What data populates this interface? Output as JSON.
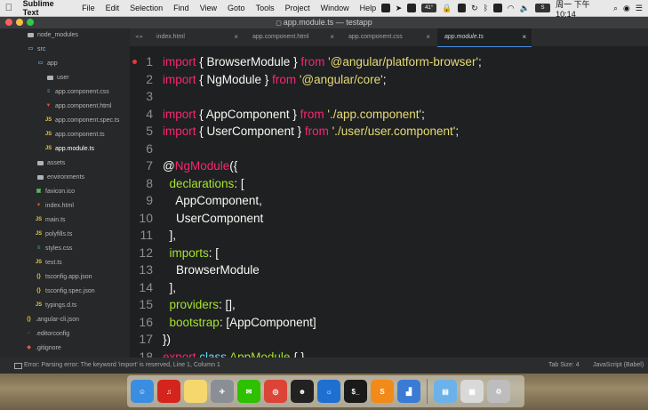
{
  "menubar": {
    "app_name": "Sublime Text",
    "items": [
      "File",
      "Edit",
      "Selection",
      "Find",
      "View",
      "Goto",
      "Tools",
      "Project",
      "Window",
      "Help"
    ],
    "badges": [
      "41°",
      "S"
    ],
    "clock": "周一 下午10:14"
  },
  "window": {
    "title": "app.module.ts — testapp"
  },
  "sidebar": {
    "items": [
      {
        "label": "node_modules",
        "type": "folder"
      },
      {
        "label": "src",
        "type": "folder"
      },
      {
        "label": "app",
        "type": "folder"
      },
      {
        "label": "user",
        "type": "folder"
      },
      {
        "label": "app.component.css",
        "type": "css"
      },
      {
        "label": "app.component.html",
        "type": "html"
      },
      {
        "label": "app.component.spec.ts",
        "type": "js"
      },
      {
        "label": "app.component.ts",
        "type": "js"
      },
      {
        "label": "app.module.ts",
        "type": "js"
      },
      {
        "label": "assets",
        "type": "folder"
      },
      {
        "label": "environments",
        "type": "folder"
      },
      {
        "label": "favicon.ico",
        "type": "img"
      },
      {
        "label": "index.html",
        "type": "html"
      },
      {
        "label": "main.ts",
        "type": "js"
      },
      {
        "label": "polyfills.ts",
        "type": "js"
      },
      {
        "label": "styles.css",
        "type": "css"
      },
      {
        "label": "test.ts",
        "type": "js"
      },
      {
        "label": "tsconfig.app.json",
        "type": "json"
      },
      {
        "label": "tsconfig.spec.json",
        "type": "json"
      },
      {
        "label": "typings.d.ts",
        "type": "js"
      },
      {
        "label": ".angular-cli.json",
        "type": "json"
      },
      {
        "label": ".editorconfig",
        "type": "config"
      },
      {
        "label": ".gitignore",
        "type": "git"
      }
    ]
  },
  "tabs": [
    {
      "label": "index.html"
    },
    {
      "label": "app.component.html"
    },
    {
      "label": "app.component.css"
    },
    {
      "label": "app.module.ts"
    }
  ],
  "tab_nav": "◂ ▸",
  "tab_close": "×",
  "code": {
    "lines": [
      {
        "n": "1",
        "t": [
          [
            "kw",
            "import"
          ],
          [
            "punc",
            " { BrowserModule } "
          ],
          [
            "kw",
            "from"
          ],
          [
            "punc",
            " "
          ],
          [
            "str",
            "'@angular/platform-browser'"
          ],
          [
            "punc",
            ";"
          ]
        ]
      },
      {
        "n": "2",
        "t": [
          [
            "kw",
            "import"
          ],
          [
            "punc",
            " { NgModule } "
          ],
          [
            "kw",
            "from"
          ],
          [
            "punc",
            " "
          ],
          [
            "str",
            "'@angular/core'"
          ],
          [
            "punc",
            ";"
          ]
        ]
      },
      {
        "n": "3",
        "t": []
      },
      {
        "n": "4",
        "t": [
          [
            "kw",
            "import"
          ],
          [
            "punc",
            " { AppComponent } "
          ],
          [
            "kw",
            "from"
          ],
          [
            "punc",
            " "
          ],
          [
            "str",
            "'./app.component'"
          ],
          [
            "punc",
            ";"
          ]
        ]
      },
      {
        "n": "5",
        "t": [
          [
            "kw",
            "import"
          ],
          [
            "punc",
            " { UserComponent } "
          ],
          [
            "kw",
            "from"
          ],
          [
            "punc",
            " "
          ],
          [
            "str",
            "'./user/user.component'"
          ],
          [
            "punc",
            ";"
          ]
        ]
      },
      {
        "n": "6",
        "t": []
      },
      {
        "n": "7",
        "t": [
          [
            "punc",
            "@"
          ],
          [
            "kw",
            "NgModule"
          ],
          [
            "punc",
            "({"
          ]
        ]
      },
      {
        "n": "8",
        "t": [
          [
            "punc",
            "  "
          ],
          [
            "fn",
            "declarations"
          ],
          [
            "punc",
            ": ["
          ]
        ]
      },
      {
        "n": "9",
        "t": [
          [
            "punc",
            "    AppComponent,"
          ]
        ]
      },
      {
        "n": "10",
        "t": [
          [
            "punc",
            "    UserComponent"
          ]
        ]
      },
      {
        "n": "11",
        "t": [
          [
            "punc",
            "  ],"
          ]
        ]
      },
      {
        "n": "12",
        "t": [
          [
            "punc",
            "  "
          ],
          [
            "fn",
            "imports"
          ],
          [
            "punc",
            ": ["
          ]
        ]
      },
      {
        "n": "13",
        "t": [
          [
            "punc",
            "    BrowserModule"
          ]
        ]
      },
      {
        "n": "14",
        "t": [
          [
            "punc",
            "  ],"
          ]
        ]
      },
      {
        "n": "15",
        "t": [
          [
            "punc",
            "  "
          ],
          [
            "fn",
            "providers"
          ],
          [
            "punc",
            ": [],"
          ]
        ]
      },
      {
        "n": "16",
        "t": [
          [
            "punc",
            "  "
          ],
          [
            "fn",
            "bootstrap"
          ],
          [
            "punc",
            ": [AppComponent]"
          ]
        ]
      },
      {
        "n": "17",
        "t": [
          [
            "punc",
            "})"
          ]
        ]
      },
      {
        "n": "18",
        "t": [
          [
            "kw",
            "export"
          ],
          [
            "punc",
            " "
          ],
          [
            "cls",
            "class"
          ],
          [
            "punc",
            " "
          ],
          [
            "fn",
            "AppModule"
          ],
          [
            "punc",
            " { }"
          ]
        ]
      }
    ]
  },
  "statusbar": {
    "message": "Error: Parsing error: The keyword 'import' is reserved, Line 1, Column 1",
    "tab_size": "Tab Size: 4",
    "syntax": "JavaScript (Babel)"
  },
  "dock": {
    "apps": [
      {
        "name": "finder-icon",
        "color": "#3b8de0",
        "glyph": "☺"
      },
      {
        "name": "netease-music-icon",
        "color": "#d4241c",
        "glyph": "♫"
      },
      {
        "name": "notes-icon",
        "color": "#f5d76e",
        "glyph": ""
      },
      {
        "name": "launchpad-icon",
        "color": "#8a8f96",
        "glyph": "✈"
      },
      {
        "name": "wechat-icon",
        "color": "#2dc100",
        "glyph": "✉"
      },
      {
        "name": "chrome-icon",
        "color": "#db4437",
        "glyph": "◎"
      },
      {
        "name": "qq-icon",
        "color": "#222222",
        "glyph": "☻"
      },
      {
        "name": "xmind-icon",
        "color": "#1f6fd1",
        "glyph": "☼"
      },
      {
        "name": "terminal-icon",
        "color": "#1a1a1a",
        "glyph": "$_"
      },
      {
        "name": "sublime-icon",
        "color": "#f28a19",
        "glyph": "S"
      },
      {
        "name": "keynote-icon",
        "color": "#3a7bd5",
        "glyph": "▟"
      }
    ],
    "extras": [
      {
        "name": "downloads-folder-icon",
        "color": "#6cb2e8",
        "glyph": "▤"
      },
      {
        "name": "documents-icon",
        "color": "#d9d9d9",
        "glyph": "▦"
      },
      {
        "name": "trash-icon",
        "color": "#bdbdbd",
        "glyph": "♲"
      }
    ]
  }
}
